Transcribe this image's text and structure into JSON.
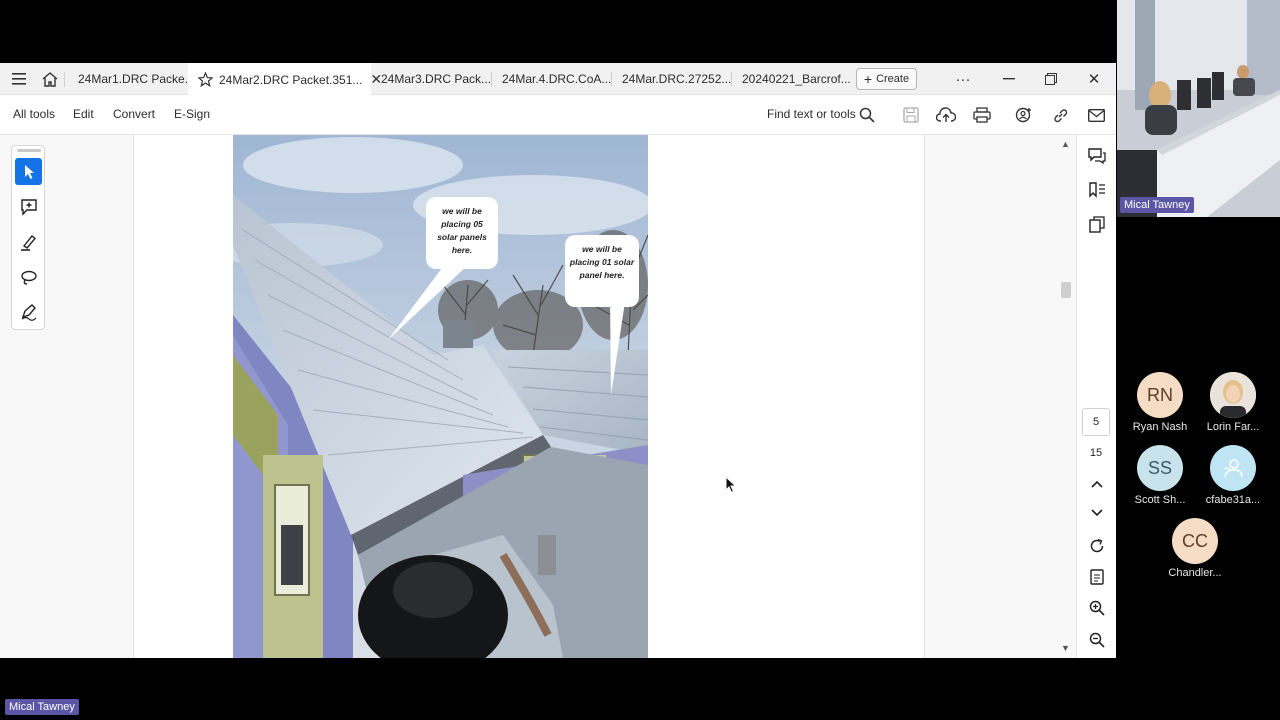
{
  "tabs": [
    {
      "label": "24Mar1.DRC Packe...",
      "active": false
    },
    {
      "label": "24Mar2.DRC Packet.351...",
      "active": true
    },
    {
      "label": "24Mar3.DRC Pack...",
      "active": false
    },
    {
      "label": "24Mar.4.DRC.CoA...",
      "active": false
    },
    {
      "label": "24Mar.DRC.27252...",
      "active": false
    },
    {
      "label": "20240221_Barcrof...",
      "active": false
    }
  ],
  "create_label": "Create",
  "toolbar": {
    "all_tools": "All tools",
    "edit": "Edit",
    "convert": "Convert",
    "esign": "E-Sign",
    "find_label": "Find text or tools"
  },
  "icons": {
    "left_rail": [
      "select-icon",
      "add-comment-icon",
      "highlight-icon",
      "draw-icon",
      "sign-icon"
    ],
    "right_rail": [
      "comments-icon",
      "bookmarks-icon",
      "pages-icon",
      "rotate-icon",
      "fit-page-icon",
      "zoom-in-icon",
      "zoom-out-icon"
    ]
  },
  "document": {
    "callout_1": "we will be placing 05 solar panels here.",
    "callout_2": "we will be placing 01 solar panel here."
  },
  "pagination": {
    "current_page": "5",
    "total_pages": "15"
  },
  "meeting": {
    "presenter_name": "Mical Tawney",
    "bottom_name": "Mical Tawney",
    "participants": [
      {
        "initials": "RN",
        "name": "Ryan Nash",
        "color": "#f5dcc4"
      },
      {
        "initials": "",
        "name": "Lorin Far...",
        "color": "#e9e3db"
      },
      {
        "initials": "SS",
        "name": "Scott Sh...",
        "color": "#c9e3ec"
      },
      {
        "initials": "",
        "name": "cfabe31a...",
        "color": "#bfe4f4"
      },
      {
        "initials": "CC",
        "name": "Chandler...",
        "color": "#f5dcc4"
      }
    ]
  },
  "colors": {
    "accent": "#1473e6",
    "teams_tag": "#5b57a6"
  }
}
